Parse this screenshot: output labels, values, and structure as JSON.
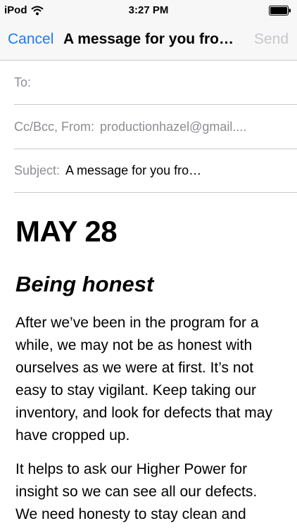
{
  "status_bar": {
    "carrier": "iPod",
    "time": "3:27 PM"
  },
  "nav": {
    "cancel_label": "Cancel",
    "title": "A message for you fro…",
    "send_label": "Send"
  },
  "fields": {
    "to_label": "To:",
    "to_value": "",
    "cc_label": "Cc/Bcc, From:",
    "cc_value": "productionhazel@gmail....",
    "subject_label": "Subject:",
    "subject_value": "A message for you fro…"
  },
  "message": {
    "date": "MAY 28",
    "heading": "Being honest",
    "paragraphs": [
      "After we’ve been in the program for a while, we may not be as honest with ourselves as we were at first. It’s not easy to stay vigilant. Keep taking our inventory, and look for defects that may have cropped up.",
      "It helps to ask our Higher Power for insight so we can see all our defects. We need honesty to stay clean and"
    ]
  }
}
